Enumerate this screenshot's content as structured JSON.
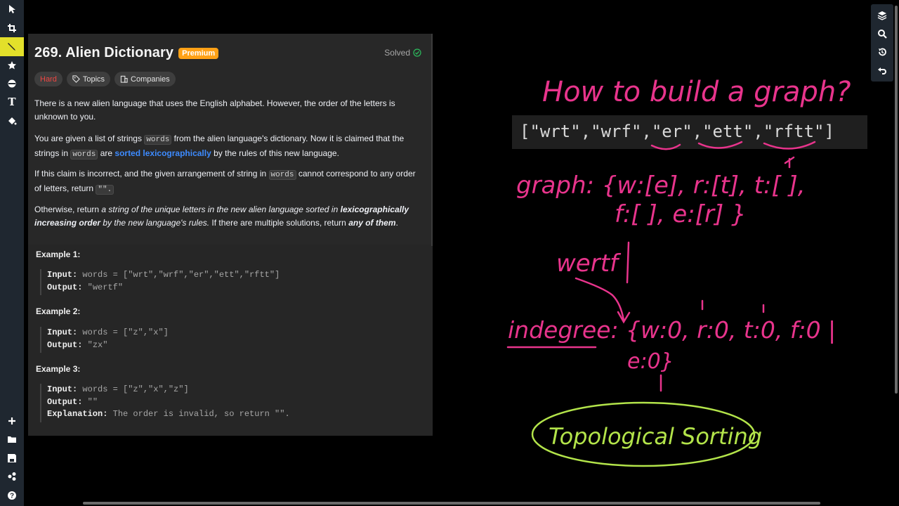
{
  "problem": {
    "title": "269. Alien Dictionary",
    "badge": "Premium",
    "status": "Solved",
    "tags": [
      "Hard",
      "Topics",
      "Companies"
    ]
  },
  "description": {
    "p1": "There is a new alien language that uses the English alphabet. However, the order of the letters is unknown to you.",
    "p2_a": "You are given a list of strings ",
    "p2_code": "words",
    "p2_b": " from the alien language's dictionary. Now it is claimed that the strings in ",
    "p2_code2": "words",
    "p2_c": " are ",
    "p2_link": "sorted lexicographically",
    "p2_d": " by the rules of this new language.",
    "p3_a": "If this claim is incorrect, and the given arrangement of string in ",
    "p3_code": "words",
    "p3_b": " cannot correspond to any order of letters, return ",
    "p3_code2": "\"\".",
    "p4_a": "Otherwise, return ",
    "p4_i1": "a string of the unique letters in the new alien language sorted in ",
    "p4_bi1": "lexicographically increasing order",
    "p4_i2": " by the new language's rules.",
    "p4_b": " If there are multiple solutions, return ",
    "p4_bi2": "any of them",
    "p4_c": "."
  },
  "examples": [
    {
      "title": "Example 1:",
      "input_label": "Input:",
      "input": " words = [\"wrt\",\"wrf\",\"er\",\"ett\",\"rftt\"]",
      "output_label": "Output:",
      "output": " \"wertf\""
    },
    {
      "title": "Example 2:",
      "input_label": "Input:",
      "input": " words = [\"z\",\"x\"]",
      "output_label": "Output:",
      "output": " \"zx\""
    },
    {
      "title": "Example 3:",
      "input_label": "Input:",
      "input": " words = [\"z\",\"x\",\"z\"]",
      "output_label": "Output:",
      "output": " \"\"",
      "explanation_label": "Explanation:",
      "explanation": " The order is invalid, so return \"\"."
    }
  ],
  "whiteboard": {
    "question": "How to build a graph?",
    "array": "[\"wrt\",\"wrf\",\"er\",\"ett\",\"rftt\"]",
    "graph_line1": "graph: {w:[e], r:[t], t:[ ],",
    "graph_line2": "f:[ ], e:[r]  }",
    "result": "wertf",
    "indegree_line1": "indegree: {w:0, r:0, t:0, f:0 |",
    "indegree_line2": "e:0}",
    "topo": "Topological  Sorting",
    "ink_pink": "#e8348c",
    "ink_green": "#b3e44a"
  },
  "toolbar": {
    "left_icons": [
      "cursor-icon",
      "crop-icon",
      "pen-icon",
      "star-icon",
      "eraser-icon",
      "text-icon",
      "fill-icon"
    ],
    "left_bottom_icons": [
      "plus-icon",
      "folder-icon",
      "save-icon",
      "settings-icon",
      "help-icon"
    ],
    "right_icons": [
      "layers-icon",
      "zoom-icon",
      "history-icon",
      "undo-icon"
    ],
    "text_glyph": "T",
    "help_glyph": "?"
  },
  "colors": {
    "panel_bg": "#282828",
    "accent_premium": "#ffa116",
    "hard": "#ef4743",
    "link": "#3d8bff",
    "solved_check": "#2cbb5d"
  }
}
